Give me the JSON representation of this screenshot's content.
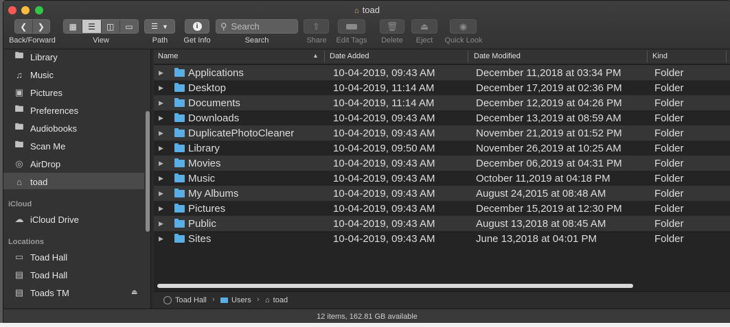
{
  "window": {
    "title": "toad"
  },
  "toolbar": {
    "back_forward_label": "Back/Forward",
    "view_label": "View",
    "path_label": "Path",
    "get_info_label": "Get Info",
    "search_label": "Search",
    "search_placeholder": "Search",
    "share_label": "Share",
    "edit_tags_label": "Edit Tags",
    "delete_label": "Delete",
    "eject_label": "Eject",
    "quick_look_label": "Quick Look"
  },
  "sidebar": {
    "favorites": [
      {
        "label": "Library",
        "icon": "folder-icon"
      },
      {
        "label": "Music",
        "icon": "music-note-icon"
      },
      {
        "label": "Pictures",
        "icon": "camera-icon"
      },
      {
        "label": "Preferences",
        "icon": "folder-icon"
      },
      {
        "label": "Audiobooks",
        "icon": "folder-icon"
      },
      {
        "label": "Scan Me",
        "icon": "folder-icon"
      },
      {
        "label": "AirDrop",
        "icon": "airdrop-icon"
      },
      {
        "label": "toad",
        "icon": "home-icon"
      }
    ],
    "icloud_heading": "iCloud",
    "icloud_items": [
      {
        "label": "iCloud Drive",
        "icon": "cloud-icon"
      }
    ],
    "locations_heading": "Locations",
    "locations": [
      {
        "label": "Toad Hall",
        "icon": "computer-icon"
      },
      {
        "label": "Toad Hall",
        "icon": "disk-icon"
      },
      {
        "label": "Toads TM",
        "icon": "disk-icon"
      }
    ]
  },
  "columns": {
    "name": "Name",
    "date_added": "Date Added",
    "date_modified": "Date Modified",
    "kind": "Kind"
  },
  "files": [
    {
      "name": "Applications",
      "added": "10-04-2019, 09:43 AM",
      "modified": "December 11,2018 at 03:34 PM",
      "kind": "Folder"
    },
    {
      "name": "Desktop",
      "added": "10-04-2019, 11:14 AM",
      "modified": "December 17,2019 at 02:36 PM",
      "kind": "Folder"
    },
    {
      "name": "Documents",
      "added": "10-04-2019, 11:14 AM",
      "modified": "December 12,2019 at 04:26 PM",
      "kind": "Folder"
    },
    {
      "name": "Downloads",
      "added": "10-04-2019, 09:43 AM",
      "modified": "December 13,2019 at 08:59 AM",
      "kind": "Folder"
    },
    {
      "name": "DuplicatePhotoCleaner",
      "added": "10-04-2019, 09:43 AM",
      "modified": "November 21,2019 at 01:52 PM",
      "kind": "Folder"
    },
    {
      "name": "Library",
      "added": "10-04-2019, 09:50 AM",
      "modified": "November 26,2019 at 10:25 AM",
      "kind": "Folder"
    },
    {
      "name": "Movies",
      "added": "10-04-2019, 09:43 AM",
      "modified": "December 06,2019 at 04:31 PM",
      "kind": "Folder"
    },
    {
      "name": "Music",
      "added": "10-04-2019, 09:43 AM",
      "modified": "October 11,2019 at 04:18 PM",
      "kind": "Folder"
    },
    {
      "name": "My Albums",
      "added": "10-04-2019, 09:43 AM",
      "modified": "August 24,2015 at 08:48 AM",
      "kind": "Folder"
    },
    {
      "name": "Pictures",
      "added": "10-04-2019, 09:43 AM",
      "modified": "December 15,2019 at 12:30 PM",
      "kind": "Folder"
    },
    {
      "name": "Public",
      "added": "10-04-2019, 09:43 AM",
      "modified": "August 13,2018 at 08:45 AM",
      "kind": "Folder"
    },
    {
      "name": "Sites",
      "added": "10-04-2019, 09:43 AM",
      "modified": "June 13,2018 at 04:01 PM",
      "kind": "Folder"
    }
  ],
  "pathbar": {
    "items": [
      "Toad Hall",
      "Users",
      "toad"
    ]
  },
  "status": {
    "text": "12 items, 162.81 GB available"
  },
  "colors": {
    "folder": "#5aaee6",
    "selection": "#4a4a4a",
    "background": "#242424"
  }
}
